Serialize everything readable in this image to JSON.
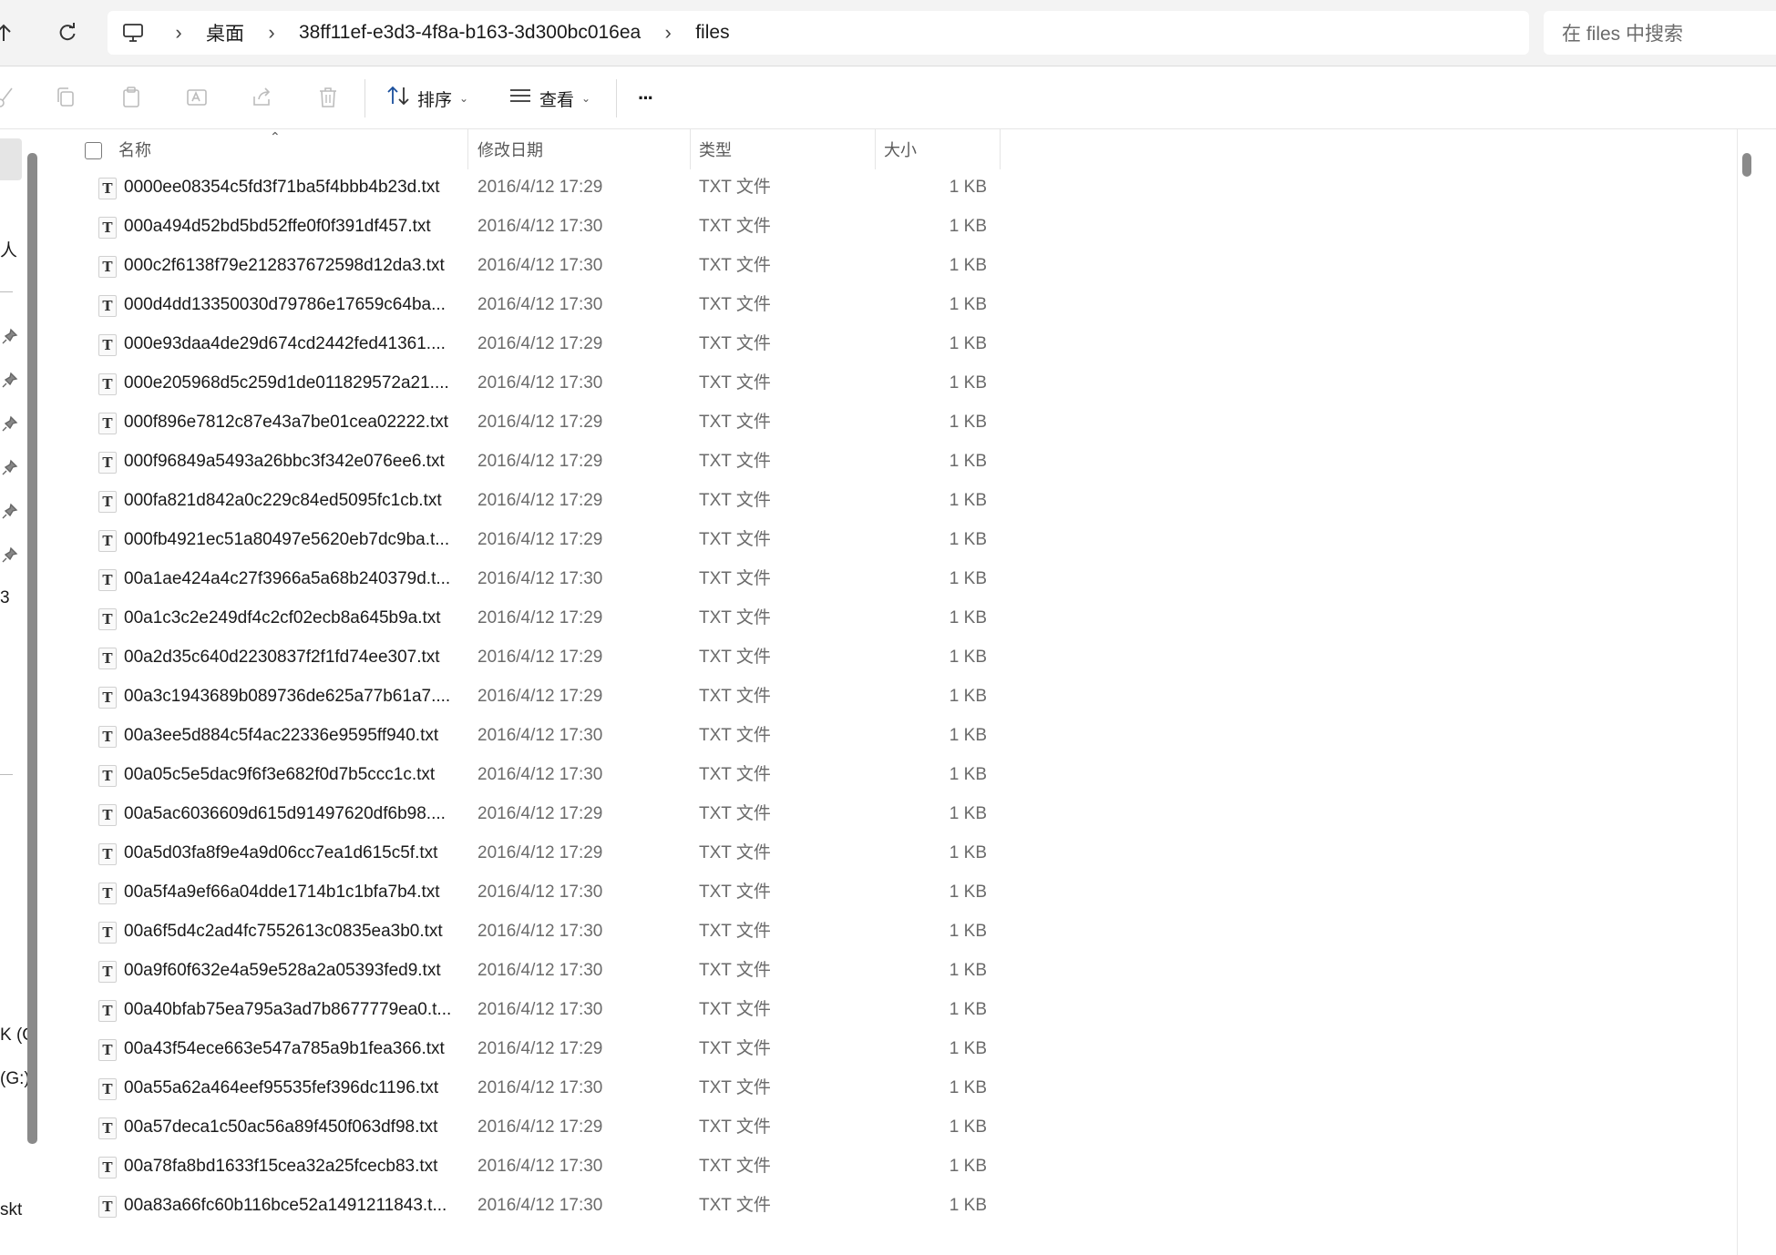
{
  "address": {
    "crumbs": [
      "桌面",
      "38ff11ef-e3d3-4f8a-b163-3d300bc016ea",
      "files"
    ]
  },
  "search": {
    "placeholder": "在 files 中搜索"
  },
  "toolbar": {
    "sort_label": "排序",
    "view_label": "查看",
    "more_label": "···"
  },
  "navpane": {
    "fragments": [
      "人",
      "3",
      "K (G",
      "(G:)",
      "skt"
    ]
  },
  "columns": {
    "name": "名称",
    "date": "修改日期",
    "type": "类型",
    "size": "大小"
  },
  "files": [
    {
      "name": "0000ee08354c5fd3f71ba5f4bbb4b23d.txt",
      "date": "2016/4/12 17:29",
      "type": "TXT 文件",
      "size": "1 KB"
    },
    {
      "name": "000a494d52bd5bd52ffe0f0f391df457.txt",
      "date": "2016/4/12 17:30",
      "type": "TXT 文件",
      "size": "1 KB"
    },
    {
      "name": "000c2f6138f79e212837672598d12da3.txt",
      "date": "2016/4/12 17:30",
      "type": "TXT 文件",
      "size": "1 KB"
    },
    {
      "name": "000d4dd13350030d79786e17659c64ba...",
      "date": "2016/4/12 17:30",
      "type": "TXT 文件",
      "size": "1 KB"
    },
    {
      "name": "000e93daa4de29d674cd2442fed41361....",
      "date": "2016/4/12 17:29",
      "type": "TXT 文件",
      "size": "1 KB"
    },
    {
      "name": "000e205968d5c259d1de011829572a21....",
      "date": "2016/4/12 17:30",
      "type": "TXT 文件",
      "size": "1 KB"
    },
    {
      "name": "000f896e7812c87e43a7be01cea02222.txt",
      "date": "2016/4/12 17:29",
      "type": "TXT 文件",
      "size": "1 KB"
    },
    {
      "name": "000f96849a5493a26bbc3f342e076ee6.txt",
      "date": "2016/4/12 17:29",
      "type": "TXT 文件",
      "size": "1 KB"
    },
    {
      "name": "000fa821d842a0c229c84ed5095fc1cb.txt",
      "date": "2016/4/12 17:29",
      "type": "TXT 文件",
      "size": "1 KB"
    },
    {
      "name": "000fb4921ec51a80497e5620eb7dc9ba.t...",
      "date": "2016/4/12 17:29",
      "type": "TXT 文件",
      "size": "1 KB"
    },
    {
      "name": "00a1ae424a4c27f3966a5a68b240379d.t...",
      "date": "2016/4/12 17:30",
      "type": "TXT 文件",
      "size": "1 KB"
    },
    {
      "name": "00a1c3c2e249df4c2cf02ecb8a645b9a.txt",
      "date": "2016/4/12 17:29",
      "type": "TXT 文件",
      "size": "1 KB"
    },
    {
      "name": "00a2d35c640d2230837f2f1fd74ee307.txt",
      "date": "2016/4/12 17:29",
      "type": "TXT 文件",
      "size": "1 KB"
    },
    {
      "name": "00a3c1943689b089736de625a77b61a7....",
      "date": "2016/4/12 17:29",
      "type": "TXT 文件",
      "size": "1 KB"
    },
    {
      "name": "00a3ee5d884c5f4ac22336e9595ff940.txt",
      "date": "2016/4/12 17:30",
      "type": "TXT 文件",
      "size": "1 KB"
    },
    {
      "name": "00a05c5e5dac9f6f3e682f0d7b5ccc1c.txt",
      "date": "2016/4/12 17:30",
      "type": "TXT 文件",
      "size": "1 KB"
    },
    {
      "name": "00a5ac6036609d615d91497620df6b98....",
      "date": "2016/4/12 17:29",
      "type": "TXT 文件",
      "size": "1 KB"
    },
    {
      "name": "00a5d03fa8f9e4a9d06cc7ea1d615c5f.txt",
      "date": "2016/4/12 17:29",
      "type": "TXT 文件",
      "size": "1 KB"
    },
    {
      "name": "00a5f4a9ef66a04dde1714b1c1bfa7b4.txt",
      "date": "2016/4/12 17:30",
      "type": "TXT 文件",
      "size": "1 KB"
    },
    {
      "name": "00a6f5d4c2ad4fc7552613c0835ea3b0.txt",
      "date": "2016/4/12 17:30",
      "type": "TXT 文件",
      "size": "1 KB"
    },
    {
      "name": "00a9f60f632e4a59e528a2a05393fed9.txt",
      "date": "2016/4/12 17:30",
      "type": "TXT 文件",
      "size": "1 KB"
    },
    {
      "name": "00a40bfab75ea795a3ad7b8677779ea0.t...",
      "date": "2016/4/12 17:30",
      "type": "TXT 文件",
      "size": "1 KB"
    },
    {
      "name": "00a43f54ece663e547a785a9b1fea366.txt",
      "date": "2016/4/12 17:29",
      "type": "TXT 文件",
      "size": "1 KB"
    },
    {
      "name": "00a55a62a464eef95535fef396dc1196.txt",
      "date": "2016/4/12 17:30",
      "type": "TXT 文件",
      "size": "1 KB"
    },
    {
      "name": "00a57deca1c50ac56a89f450f063df98.txt",
      "date": "2016/4/12 17:29",
      "type": "TXT 文件",
      "size": "1 KB"
    },
    {
      "name": "00a78fa8bd1633f15cea32a25fcecb83.txt",
      "date": "2016/4/12 17:30",
      "type": "TXT 文件",
      "size": "1 KB"
    },
    {
      "name": "00a83a66fc60b116bce52a1491211843.t...",
      "date": "2016/4/12 17:30",
      "type": "TXT 文件",
      "size": "1 KB"
    }
  ],
  "icons": {
    "file_glyph": "T"
  }
}
